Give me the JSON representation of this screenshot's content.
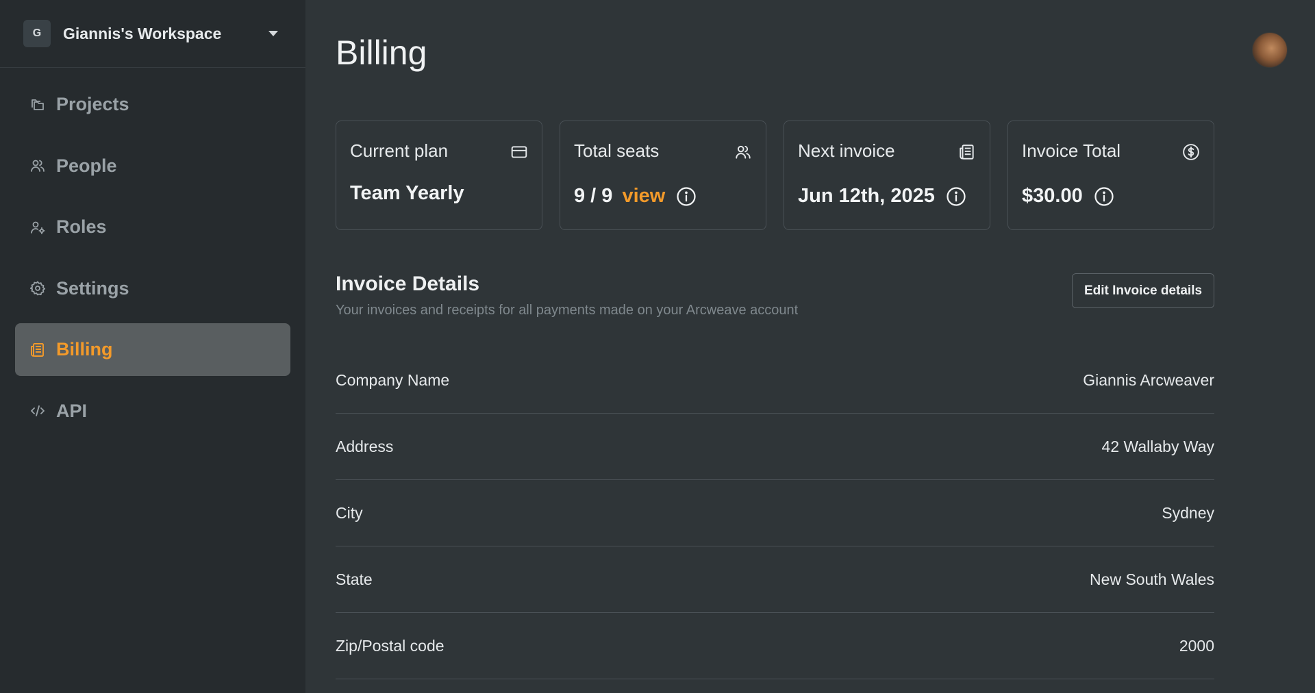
{
  "workspace": {
    "initial": "G",
    "name": "Giannis's Workspace"
  },
  "sidebar": {
    "items": [
      {
        "label": "Projects",
        "icon": "folders-icon"
      },
      {
        "label": "People",
        "icon": "users-icon"
      },
      {
        "label": "Roles",
        "icon": "user-settings-icon"
      },
      {
        "label": "Settings",
        "icon": "gear-icon"
      },
      {
        "label": "Billing",
        "icon": "receipt-icon",
        "active": true
      },
      {
        "label": "API",
        "icon": "code-icon"
      }
    ]
  },
  "page": {
    "title": "Billing"
  },
  "cards": {
    "plan": {
      "title": "Current plan",
      "value": "Team Yearly",
      "icon": "credit-card-icon"
    },
    "seats": {
      "title": "Total seats",
      "value": "9 / 9",
      "link": "view",
      "icon": "users-icon"
    },
    "next_invoice": {
      "title": "Next invoice",
      "value": "Jun 12th, 2025",
      "icon": "receipt-icon"
    },
    "total": {
      "title": "Invoice Total",
      "value": "$30.00",
      "icon": "dollar-circle-icon"
    }
  },
  "invoice_details": {
    "title": "Invoice Details",
    "subtitle": "Your invoices and receipts for all payments made on your Arcweave account",
    "edit_label": "Edit Invoice details",
    "rows": [
      {
        "label": "Company Name",
        "value": "Giannis Arcweaver"
      },
      {
        "label": "Address",
        "value": "42 Wallaby Way"
      },
      {
        "label": "City",
        "value": "Sydney"
      },
      {
        "label": "State",
        "value": "New South Wales"
      },
      {
        "label": "Zip/Postal code",
        "value": "2000"
      }
    ]
  },
  "colors": {
    "accent": "#f39a2a",
    "sidebar_bg": "#262b2e",
    "main_bg": "#2f3538",
    "active_bg": "#595e60"
  }
}
